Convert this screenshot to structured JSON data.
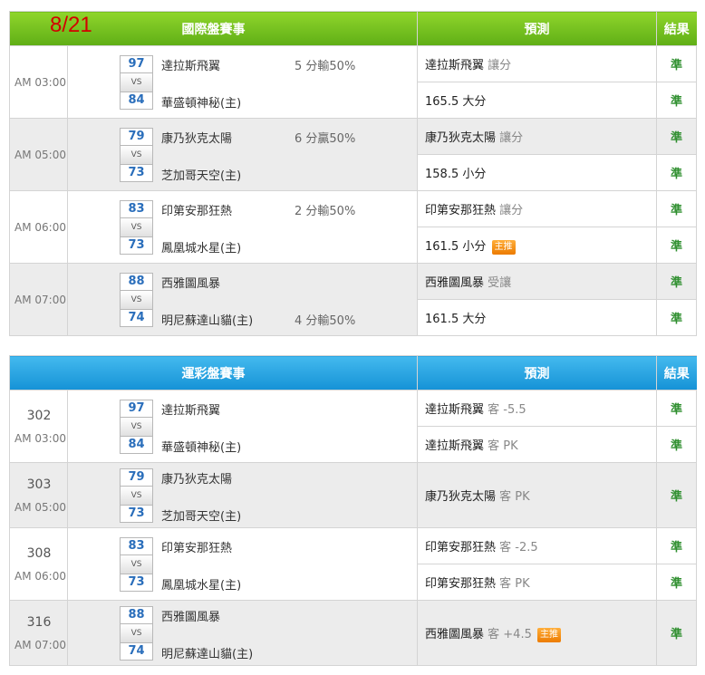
{
  "date": "8/21",
  "intl": {
    "header": {
      "title": "國際盤賽事",
      "prediction": "預測",
      "result": "結果"
    },
    "games": [
      {
        "time": "AM 03:00",
        "score_a": "97",
        "score_b": "84",
        "team_a": "達拉斯飛翼",
        "team_b": "華盛頓神秘(主)",
        "spread": "5 分輸50%",
        "spread_row": "a",
        "pred1": {
          "text": "達拉斯飛翼",
          "dim": "讓分",
          "badge": ""
        },
        "res1": "準",
        "pred2": {
          "text": "165.5 大分",
          "dim": "",
          "badge": ""
        },
        "res2": "準"
      },
      {
        "time": "AM 05:00",
        "score_a": "79",
        "score_b": "73",
        "team_a": "康乃狄克太陽",
        "team_b": "芝加哥天空(主)",
        "spread": "6 分贏50%",
        "spread_row": "a",
        "pred1": {
          "text": "康乃狄克太陽",
          "dim": "讓分",
          "badge": ""
        },
        "res1": "準",
        "pred2": {
          "text": "158.5 小分",
          "dim": "",
          "badge": ""
        },
        "res2": "準"
      },
      {
        "time": "AM 06:00",
        "score_a": "83",
        "score_b": "73",
        "team_a": "印第安那狂熱",
        "team_b": "鳳凰城水星(主)",
        "spread": "2 分輸50%",
        "spread_row": "a",
        "pred1": {
          "text": "印第安那狂熱",
          "dim": "讓分",
          "badge": ""
        },
        "res1": "準",
        "pred2": {
          "text": "161.5 小分",
          "dim": "",
          "badge": "主推"
        },
        "res2": "準"
      },
      {
        "time": "AM 07:00",
        "score_a": "88",
        "score_b": "74",
        "team_a": "西雅圖風暴",
        "team_b": "明尼蘇達山貓(主)",
        "spread": "4 分輸50%",
        "spread_row": "b",
        "pred1": {
          "text": "西雅圖風暴",
          "dim": "受讓",
          "badge": ""
        },
        "res1": "準",
        "pred2": {
          "text": "161.5 大分",
          "dim": "",
          "badge": ""
        },
        "res2": "準"
      }
    ]
  },
  "lottery": {
    "header": {
      "title": "運彩盤賽事",
      "prediction": "預測",
      "result": "結果"
    },
    "games": [
      {
        "num": "302",
        "time": "AM 03:00",
        "score_a": "97",
        "score_b": "84",
        "team_a": "達拉斯飛翼",
        "team_b": "華盛頓神秘(主)",
        "preds": [
          {
            "text": "達拉斯飛翼",
            "dim": "客 -5.5",
            "badge": "",
            "res": "準"
          },
          {
            "text": "達拉斯飛翼",
            "dim": "客 PK",
            "badge": "",
            "res": "準"
          }
        ]
      },
      {
        "num": "303",
        "time": "AM 05:00",
        "score_a": "79",
        "score_b": "73",
        "team_a": "康乃狄克太陽",
        "team_b": "芝加哥天空(主)",
        "preds": [
          {
            "text": "康乃狄克太陽",
            "dim": "客 PK",
            "badge": "",
            "res": "準"
          }
        ]
      },
      {
        "num": "308",
        "time": "AM 06:00",
        "score_a": "83",
        "score_b": "73",
        "team_a": "印第安那狂熱",
        "team_b": "鳳凰城水星(主)",
        "preds": [
          {
            "text": "印第安那狂熱",
            "dim": "客 -2.5",
            "badge": "",
            "res": "準"
          },
          {
            "text": "印第安那狂熱",
            "dim": "客 PK",
            "badge": "",
            "res": "準"
          }
        ]
      },
      {
        "num": "316",
        "time": "AM 07:00",
        "score_a": "88",
        "score_b": "74",
        "team_a": "西雅圖風暴",
        "team_b": "明尼蘇達山貓(主)",
        "preds": [
          {
            "text": "西雅圖風暴",
            "dim": "客 +4.5",
            "badge": "主推",
            "res": "準"
          }
        ]
      }
    ]
  },
  "colors": {
    "green_header": "#6cbf1c",
    "blue_header": "#2aa5e3",
    "result_green": "#2f8f2f",
    "score_blue": "#2a6ebb",
    "date_red": "#d20000",
    "badge_orange": "#f39012"
  }
}
